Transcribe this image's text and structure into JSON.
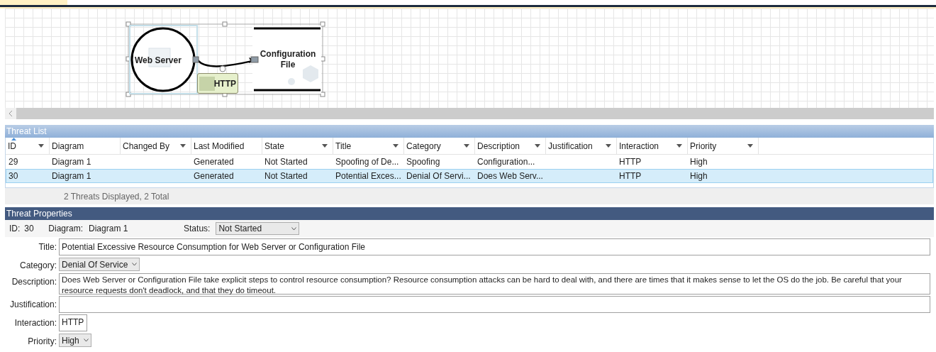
{
  "diagram": {
    "process": {
      "label": "Web Server"
    },
    "store": {
      "label": "Configuration File"
    },
    "flow": {
      "label": "HTTP"
    }
  },
  "threat_list": {
    "title": "Threat List",
    "columns": [
      {
        "label": "ID",
        "filter": true,
        "sorted": true
      },
      {
        "label": "Diagram",
        "filter": false,
        "sorted": false
      },
      {
        "label": "Changed By",
        "filter": true,
        "sorted": false
      },
      {
        "label": "Last Modified",
        "filter": false,
        "sorted": false
      },
      {
        "label": "State",
        "filter": true,
        "sorted": false
      },
      {
        "label": "Title",
        "filter": true,
        "sorted": false
      },
      {
        "label": "Category",
        "filter": true,
        "sorted": false
      },
      {
        "label": "Description",
        "filter": true,
        "sorted": false
      },
      {
        "label": "Justification",
        "filter": true,
        "sorted": false
      },
      {
        "label": "Interaction",
        "filter": true,
        "sorted": false
      },
      {
        "label": "Priority",
        "filter": true,
        "sorted": false
      }
    ],
    "rows": [
      {
        "selected": false,
        "cells": [
          "29",
          "Diagram 1",
          "",
          "Generated",
          "Not Started",
          "Spoofing of De...",
          "Spoofing",
          "Configuration...",
          "",
          "HTTP",
          "High"
        ]
      },
      {
        "selected": true,
        "cells": [
          "30",
          "Diagram 1",
          "",
          "Generated",
          "Not Started",
          "Potential Exces...",
          "Denial Of Servi...",
          "Does Web Serv...",
          "",
          "HTTP",
          "High"
        ]
      }
    ],
    "footer": "2 Threats Displayed, 2 Total"
  },
  "threat_properties": {
    "title": "Threat Properties",
    "id_label": "ID:",
    "id": "30",
    "diagram_label": "Diagram:",
    "diagram": "Diagram 1",
    "status_label": "Status:",
    "status": "Not Started",
    "fields": [
      {
        "label": "Title:",
        "kind": "text",
        "value": "Potential Excessive Resource Consumption for Web Server or Configuration File"
      },
      {
        "label": "Category:",
        "kind": "dropdown",
        "value": "Denial Of Service"
      },
      {
        "label": "Description:",
        "kind": "textarea",
        "value": "Does Web Server or Configuration File take explicit steps to control resource consumption? Resource consumption attacks can be hard to deal with, and there are times that it makes sense to let the OS do the job. Be careful that your resource requests don't deadlock, and that they do timeout."
      },
      {
        "label": "Justification:",
        "kind": "text"
      },
      {
        "label": "Interaction:",
        "kind": "small",
        "value": "HTTP"
      },
      {
        "label": "Priority:",
        "kind": "dropdown",
        "value": "High"
      }
    ]
  }
}
